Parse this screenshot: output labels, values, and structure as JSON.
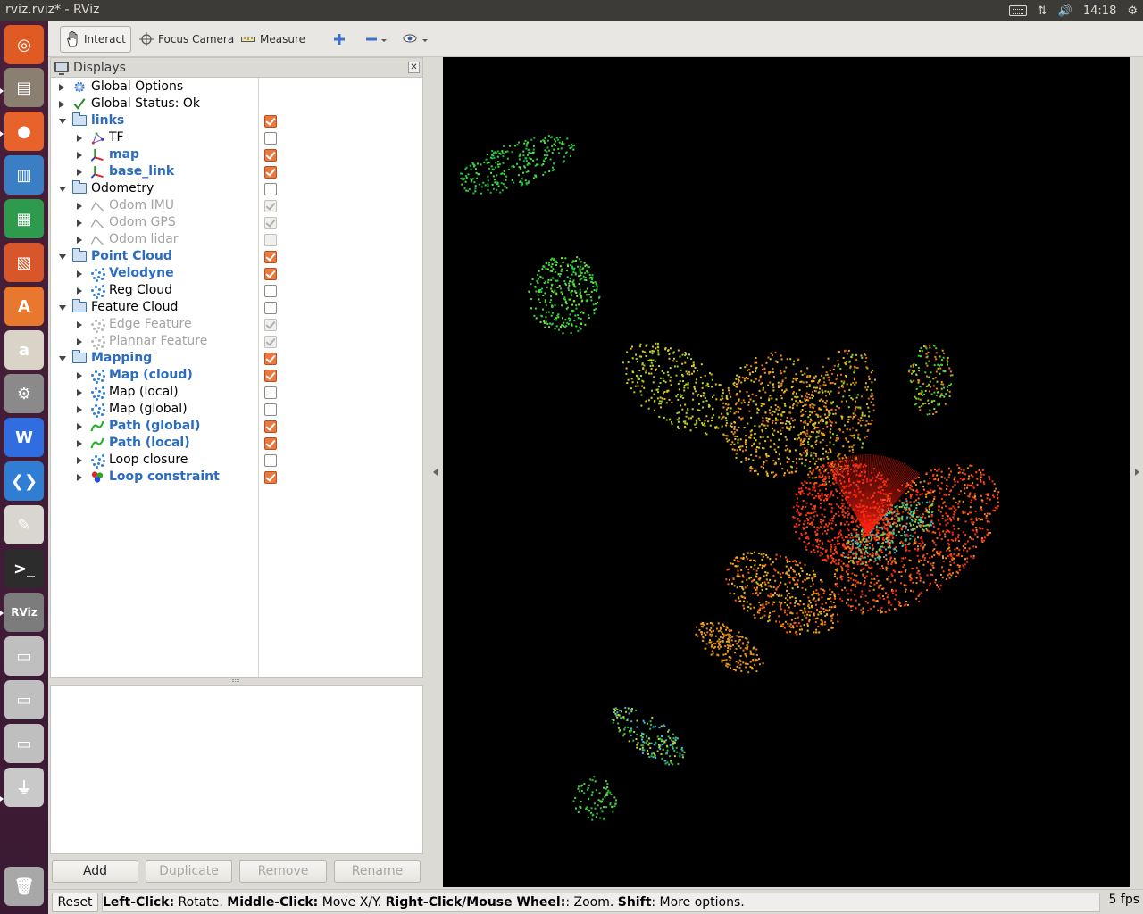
{
  "window": {
    "title": "rviz.rviz* - RViz"
  },
  "tray": {
    "time": "14:18"
  },
  "launcher": {
    "items": [
      {
        "name": "ubuntu-dash-icon",
        "color": "#e05a24",
        "glyph": "◎"
      },
      {
        "name": "files-icon",
        "color": "#8b7f72",
        "glyph": "▤"
      },
      {
        "name": "firefox-icon",
        "color": "#e8632b",
        "glyph": "●"
      },
      {
        "name": "writer-icon",
        "color": "#3a7fc4",
        "glyph": "▥"
      },
      {
        "name": "calc-icon",
        "color": "#2e9a4e",
        "glyph": "▦"
      },
      {
        "name": "impress-icon",
        "color": "#d8572a",
        "glyph": "▧"
      },
      {
        "name": "software-center-icon",
        "color": "#e7782d",
        "glyph": "A"
      },
      {
        "name": "amazon-icon",
        "color": "#d9d3c8",
        "glyph": "a"
      },
      {
        "name": "system-settings-icon",
        "color": "#8a8a8a",
        "glyph": "⚙"
      },
      {
        "name": "wps-icon",
        "color": "#2f6de0",
        "glyph": "W"
      },
      {
        "name": "vscode-icon",
        "color": "#2f7ed3",
        "glyph": "❮❯"
      },
      {
        "name": "text-editor-icon",
        "color": "#d9d6cf",
        "glyph": "✎"
      },
      {
        "name": "terminal-icon",
        "color": "#2c2c2c",
        "glyph": ">_"
      },
      {
        "name": "rviz-icon",
        "color": "#7c7c7c",
        "glyph": "RViz"
      },
      {
        "name": "drive-icon",
        "color": "#bfbfbf",
        "glyph": "▭"
      },
      {
        "name": "drive-icon",
        "color": "#bfbfbf",
        "glyph": "▭"
      },
      {
        "name": "drive-icon",
        "color": "#bfbfbf",
        "glyph": "▭"
      },
      {
        "name": "usb-drive-icon",
        "color": "#c9c9c9",
        "glyph": "⏚"
      },
      {
        "name": "trash-icon",
        "color": "#a8a8a8",
        "glyph": "🗑"
      }
    ]
  },
  "toolbar": {
    "interact": "Interact",
    "focus_camera": "Focus Camera",
    "measure": "Measure"
  },
  "displays": {
    "title": "Displays",
    "items": [
      {
        "label": "Global Options",
        "level": 0,
        "expanded": false,
        "icon": "gear-icon",
        "style": "normal",
        "checkbox": null
      },
      {
        "label": "Global Status: Ok",
        "level": 0,
        "expanded": false,
        "icon": "check-icon",
        "style": "normal",
        "checkbox": null
      },
      {
        "label": "links",
        "level": 0,
        "expanded": true,
        "icon": "folder-icon",
        "style": "bold",
        "checkbox": "on"
      },
      {
        "label": "TF",
        "level": 1,
        "expanded": false,
        "icon": "tf-icon",
        "style": "normal",
        "checkbox": "off"
      },
      {
        "label": "map",
        "level": 1,
        "expanded": false,
        "icon": "axes-icon",
        "style": "bold",
        "checkbox": "on"
      },
      {
        "label": "base_link",
        "level": 1,
        "expanded": false,
        "icon": "axes-icon",
        "style": "bold",
        "checkbox": "on"
      },
      {
        "label": "Odometry",
        "level": 0,
        "expanded": true,
        "icon": "folder-icon",
        "style": "normal",
        "checkbox": "off"
      },
      {
        "label": "Odom IMU",
        "level": 1,
        "expanded": false,
        "icon": "odometry-icon",
        "style": "disabled",
        "checkbox": "dis-on"
      },
      {
        "label": "Odom GPS",
        "level": 1,
        "expanded": false,
        "icon": "odometry-icon",
        "style": "disabled",
        "checkbox": "dis-on"
      },
      {
        "label": "Odom lidar",
        "level": 1,
        "expanded": false,
        "icon": "odometry-icon",
        "style": "disabled",
        "checkbox": "dis-off"
      },
      {
        "label": "Point Cloud",
        "level": 0,
        "expanded": true,
        "icon": "folder-icon",
        "style": "bold",
        "checkbox": "on"
      },
      {
        "label": "Velodyne",
        "level": 1,
        "expanded": false,
        "icon": "pointcloud-icon",
        "style": "bold",
        "checkbox": "on"
      },
      {
        "label": "Reg Cloud",
        "level": 1,
        "expanded": false,
        "icon": "pointcloud-icon",
        "style": "normal",
        "checkbox": "off"
      },
      {
        "label": "Feature Cloud",
        "level": 0,
        "expanded": true,
        "icon": "folder-icon",
        "style": "normal",
        "checkbox": "off"
      },
      {
        "label": "Edge Feature",
        "level": 1,
        "expanded": false,
        "icon": "pointcloud-grey-icon",
        "style": "disabled",
        "checkbox": "dis-on"
      },
      {
        "label": "Plannar Feature",
        "level": 1,
        "expanded": false,
        "icon": "pointcloud-grey-icon",
        "style": "disabled",
        "checkbox": "dis-on"
      },
      {
        "label": "Mapping",
        "level": 0,
        "expanded": true,
        "icon": "folder-icon",
        "style": "bold",
        "checkbox": "on"
      },
      {
        "label": "Map (cloud)",
        "level": 1,
        "expanded": false,
        "icon": "pointcloud-icon",
        "style": "bold",
        "checkbox": "on"
      },
      {
        "label": "Map (local)",
        "level": 1,
        "expanded": false,
        "icon": "pointcloud-icon",
        "style": "normal",
        "checkbox": "off"
      },
      {
        "label": "Map (global)",
        "level": 1,
        "expanded": false,
        "icon": "pointcloud-icon",
        "style": "normal",
        "checkbox": "off"
      },
      {
        "label": "Path (global)",
        "level": 1,
        "expanded": false,
        "icon": "path-icon",
        "style": "bold",
        "checkbox": "on"
      },
      {
        "label": "Path (local)",
        "level": 1,
        "expanded": false,
        "icon": "path-icon",
        "style": "bold",
        "checkbox": "on"
      },
      {
        "label": "Loop closure",
        "level": 1,
        "expanded": false,
        "icon": "pointcloud-icon",
        "style": "normal",
        "checkbox": "off"
      },
      {
        "label": "Loop constraint",
        "level": 1,
        "expanded": false,
        "icon": "marker-array-icon",
        "style": "bold",
        "checkbox": "on"
      }
    ]
  },
  "buttons": {
    "add": "Add",
    "duplicate": "Duplicate",
    "remove": "Remove",
    "rename": "Rename"
  },
  "status": {
    "reset": "Reset",
    "hint_parts": [
      {
        "text": "Left-Click:",
        "bold": true
      },
      {
        "text": " Rotate. ",
        "bold": false
      },
      {
        "text": "Middle-Click:",
        "bold": true
      },
      {
        "text": " Move X/Y. ",
        "bold": false
      },
      {
        "text": "Right-Click/Mouse Wheel:",
        "bold": true
      },
      {
        "text": ": Zoom. ",
        "bold": false
      },
      {
        "text": "Shift",
        "bold": true
      },
      {
        "text": ": More options.",
        "bold": false
      }
    ],
    "fps": "5 fps"
  },
  "colors": {
    "accent_blue": "#2b6cc0",
    "checkbox_on": "#e9793f",
    "launcher_bg": "#3a1a33",
    "panel_bg": "#dcdad5"
  }
}
